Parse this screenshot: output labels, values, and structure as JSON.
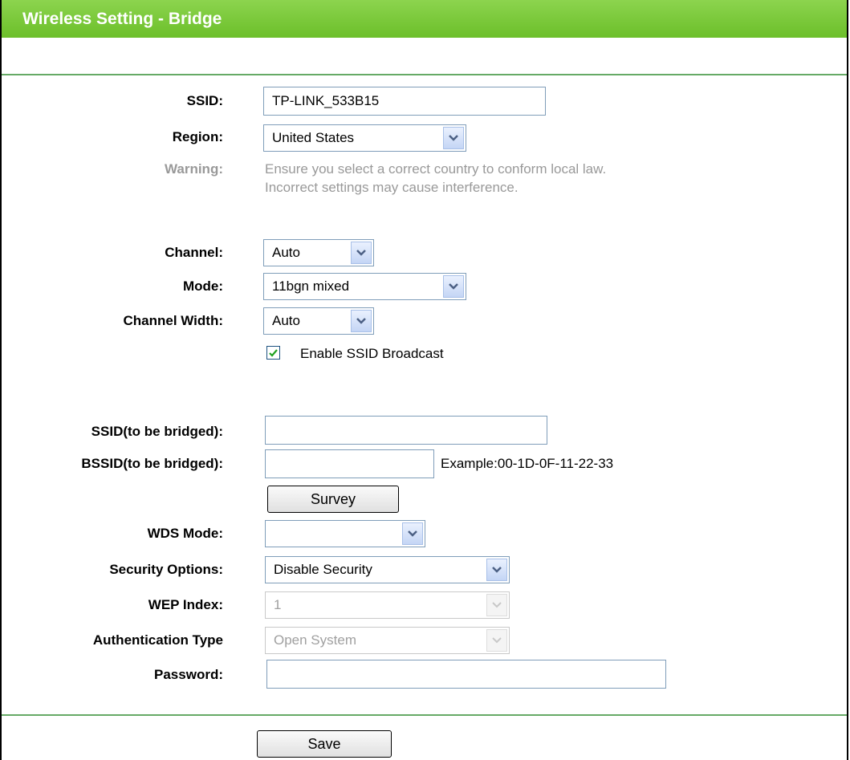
{
  "header": {
    "title": "Wireless Setting - Bridge"
  },
  "form": {
    "ssid": {
      "label": "SSID:",
      "value": "TP-LINK_533B15"
    },
    "region": {
      "label": "Region:",
      "value": "United States"
    },
    "warning": {
      "label": "Warning:",
      "line1": "Ensure you select a correct country to conform local law.",
      "line2": "Incorrect settings may cause interference."
    },
    "channel": {
      "label": "Channel:",
      "value": "Auto"
    },
    "mode": {
      "label": "Mode:",
      "value": "11bgn mixed"
    },
    "channel_width": {
      "label": "Channel Width:",
      "value": "Auto"
    },
    "ssid_broadcast": {
      "label": "Enable SSID Broadcast",
      "checked": true
    },
    "ssid_bridged": {
      "label": "SSID(to be bridged):",
      "value": ""
    },
    "bssid_bridged": {
      "label": "BSSID(to be bridged):",
      "value": "",
      "example": "Example:00-1D-0F-11-22-33"
    },
    "survey_button": "Survey",
    "wds_mode": {
      "label": "WDS Mode:",
      "value": ""
    },
    "security_options": {
      "label": "Security Options:",
      "value": "Disable Security"
    },
    "wep_index": {
      "label": "WEP Index:",
      "value": "1"
    },
    "auth_type": {
      "label": "Authentication Type",
      "value": "Open System"
    },
    "password": {
      "label": "Password:",
      "value": ""
    }
  },
  "footer": {
    "save_button": "Save"
  },
  "colors": {
    "header_green": "#78c83a",
    "divider": "#66aa66",
    "disabled_text": "#999999"
  },
  "icons": {
    "dropdown": "chevron-down-icon",
    "checkbox": "checkmark-icon"
  }
}
